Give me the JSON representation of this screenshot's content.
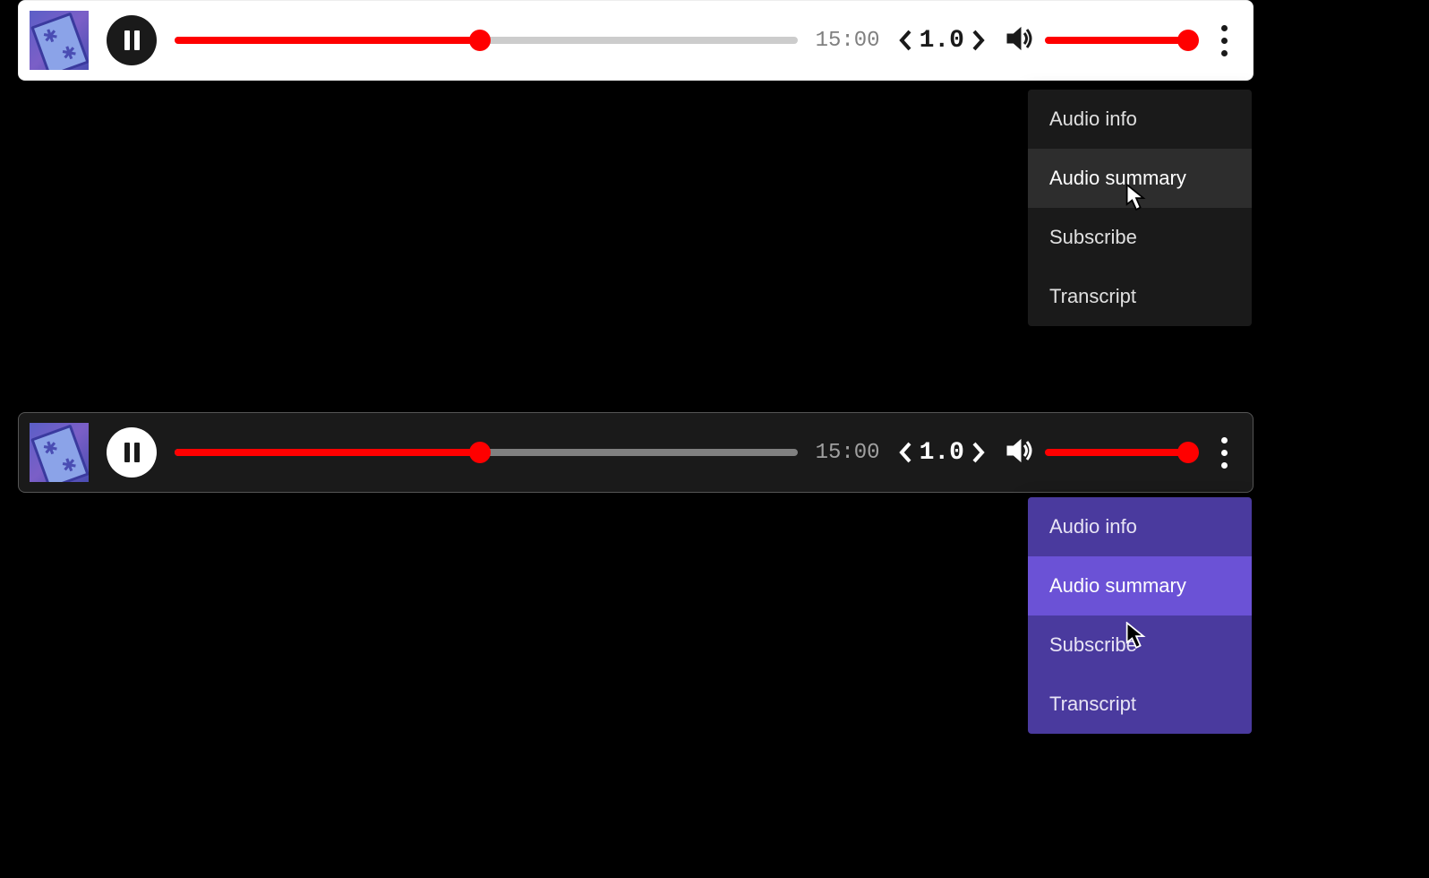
{
  "player": {
    "timecode": "15:00",
    "speed": "1.0",
    "progress_percent": 49,
    "volume_percent": 100
  },
  "menu": {
    "items": [
      {
        "label": "Audio info",
        "hovered": false
      },
      {
        "label": "Audio summary",
        "hovered": true
      },
      {
        "label": "Subscribe",
        "hovered": false
      },
      {
        "label": "Transcript",
        "hovered": false
      }
    ]
  },
  "colors": {
    "accent": "#f00",
    "purple_menu": "#4a3a9e",
    "purple_hover": "#6b52d6"
  }
}
